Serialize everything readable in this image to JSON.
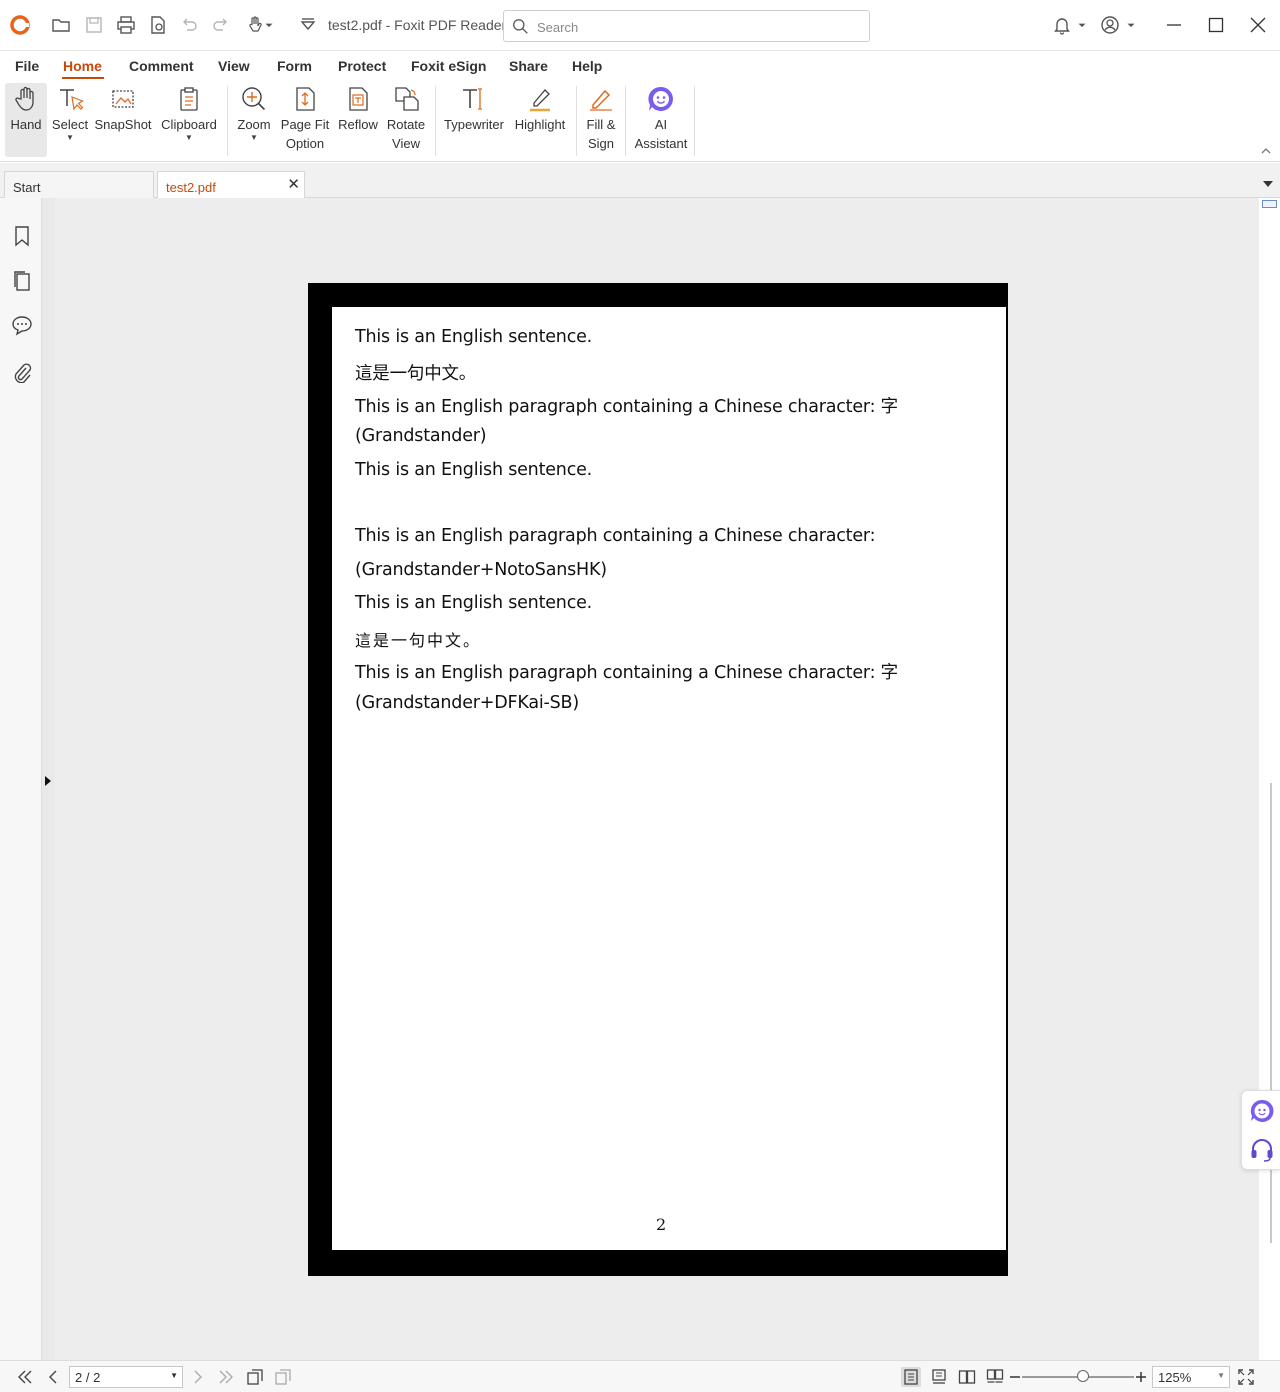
{
  "titlebar": {
    "title": "test2.pdf - Foxit PDF Reader",
    "search_placeholder": "Search"
  },
  "menu": {
    "items": [
      "File",
      "Home",
      "Comment",
      "View",
      "Form",
      "Protect",
      "Foxit eSign",
      "Share",
      "Help"
    ],
    "active": "Home"
  },
  "ribbon": {
    "hand": "Hand",
    "select": "Select",
    "snapshot": "SnapShot",
    "clipboard": "Clipboard",
    "zoom": "Zoom",
    "page_fit_1": "Page Fit",
    "page_fit_2": "Option",
    "reflow": "Reflow",
    "rotate_1": "Rotate",
    "rotate_2": "View",
    "typewriter": "Typewriter",
    "highlight": "Highlight",
    "fill_sign_1": "Fill &",
    "fill_sign_2": "Sign",
    "ai_1": "AI",
    "ai_2": "Assistant"
  },
  "tabs": {
    "start": "Start",
    "file": "test2.pdf"
  },
  "document": {
    "lines": [
      "This is an English sentence.",
      "這是一句中文。",
      "This is an English paragraph containing a Chinese character: 字",
      "(Grandstander)",
      "This is an English sentence.",
      "",
      "This is an English paragraph containing a Chinese character:",
      "(Grandstander+NotoSansHK)",
      "This is an English sentence.",
      "這是一句中文。",
      "This is an English paragraph containing a Chinese character: 字",
      "(Grandstander+DFKai-SB)"
    ],
    "page_number": "2"
  },
  "statusbar": {
    "page_indicator": "2 / 2",
    "zoom": "125%"
  },
  "colors": {
    "accent": "#c8490a",
    "ai_purple": "#7b5cf0"
  }
}
